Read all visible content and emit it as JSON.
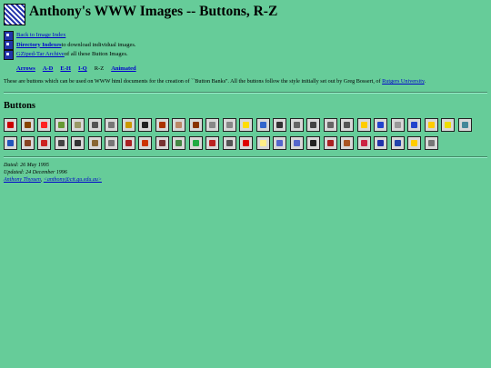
{
  "page": {
    "title": "Anthony's WWW Images -- Buttons, R-Z",
    "links": [
      {
        "text": "Back to Image Index",
        "suffix": ""
      },
      {
        "text": "Directory Indexes",
        "suffix": " to download individual images."
      },
      {
        "text": "GZiped-Tar Archive",
        "suffix": " of all these Button Images."
      }
    ],
    "nav": [
      "Arrows",
      "A-D",
      "E-H",
      "I-Q",
      "R-Z",
      "Animated"
    ],
    "nav_current": "R-Z",
    "description_prefix": "These are buttons which can be used on WWW html documents for the creation of ``Button Banks''. All the buttons follow the style initially set out by Greg Bossert, of ",
    "description_link": "Rutgers University",
    "description_suffix": ".",
    "section_title": "Buttons",
    "footer": {
      "dated": "Dated: 26 May 1995",
      "updated": "Updated: 24 December 1996",
      "author": "Anthony Thyssen",
      "email": "<anthony@cit.gu.edu.au>"
    }
  },
  "icons_row1": [
    {
      "name": "red-cross-icon",
      "color": "#cc0000"
    },
    {
      "name": "document-icon",
      "color": "#884400"
    },
    {
      "name": "star-burst-icon",
      "color": "#ff2222"
    },
    {
      "name": "pencil-icon",
      "color": "#669933"
    },
    {
      "name": "ruler-icon",
      "color": "#999966"
    },
    {
      "name": "magnifier-icon",
      "color": "#555555"
    },
    {
      "name": "magnifier-2-icon",
      "color": "#777777"
    },
    {
      "name": "key-icon",
      "color": "#cc9900"
    },
    {
      "name": "face-icon",
      "color": "#222222"
    },
    {
      "name": "rocket-icon",
      "color": "#aa3300"
    },
    {
      "name": "hand-icon",
      "color": "#bb8866"
    },
    {
      "name": "book-icon",
      "color": "#883300"
    },
    {
      "name": "table-icon",
      "color": "#888888"
    },
    {
      "name": "table-2-icon",
      "color": "#888888"
    },
    {
      "name": "smiley-icon",
      "color": "#ffdd00"
    },
    {
      "name": "sphere-icon",
      "color": "#3366cc"
    },
    {
      "name": "spider-icon",
      "color": "#333333"
    },
    {
      "name": "eye-icon",
      "color": "#666666"
    },
    {
      "name": "horn-icon",
      "color": "#444444"
    },
    {
      "name": "stick-icon",
      "color": "#666666"
    },
    {
      "name": "pen-icon",
      "color": "#555555"
    },
    {
      "name": "star-icon",
      "color": "#ffcc00"
    },
    {
      "name": "bar-chart-icon",
      "color": "#2244cc"
    },
    {
      "name": "table-3-icon",
      "color": "#999999"
    },
    {
      "name": "skyline-icon",
      "color": "#2244cc"
    },
    {
      "name": "sun-icon",
      "color": "#ffcc00"
    },
    {
      "name": "sunglasses-icon",
      "color": "#eedd00"
    },
    {
      "name": "tape-icon",
      "color": "#448899"
    }
  ],
  "icons_row2": [
    {
      "name": "terminal-icon",
      "color": "#2255bb"
    },
    {
      "name": "desk-icon",
      "color": "#884422"
    },
    {
      "name": "flag-icon",
      "color": "#cc2222"
    },
    {
      "name": "tree-icon",
      "color": "#444444"
    },
    {
      "name": "footprints-icon",
      "color": "#333333"
    },
    {
      "name": "tape-reel-icon",
      "color": "#886633"
    },
    {
      "name": "tools-icon",
      "color": "#777777"
    },
    {
      "name": "candles-icon",
      "color": "#aa2222"
    },
    {
      "name": "torch-icon",
      "color": "#cc3300"
    },
    {
      "name": "trophy-icon",
      "color": "#773333"
    },
    {
      "name": "trees-icon",
      "color": "#448844"
    },
    {
      "name": "palm-icon",
      "color": "#22aa44"
    },
    {
      "name": "us-flag-icon",
      "color": "#bb2222"
    },
    {
      "name": "umbrella-icon",
      "color": "#555555"
    },
    {
      "name": "warning-icon",
      "color": "#dd0000"
    },
    {
      "name": "speech-icon",
      "color": "#ffee88"
    },
    {
      "name": "web-icon",
      "color": "#5566cc"
    },
    {
      "name": "web-2-icon",
      "color": "#5566cc"
    },
    {
      "name": "window-icon",
      "color": "#222222"
    },
    {
      "name": "window-2-icon",
      "color": "#aa2222"
    },
    {
      "name": "xtools-icon",
      "color": "#aa5522"
    },
    {
      "name": "w-logo-icon",
      "color": "#cc2244"
    },
    {
      "name": "circle-logo-icon",
      "color": "#2233aa"
    },
    {
      "name": "x-icon",
      "color": "#2244aa"
    },
    {
      "name": "yield-icon",
      "color": "#ffcc00"
    },
    {
      "name": "zoom-icon",
      "color": "#777777"
    }
  ]
}
